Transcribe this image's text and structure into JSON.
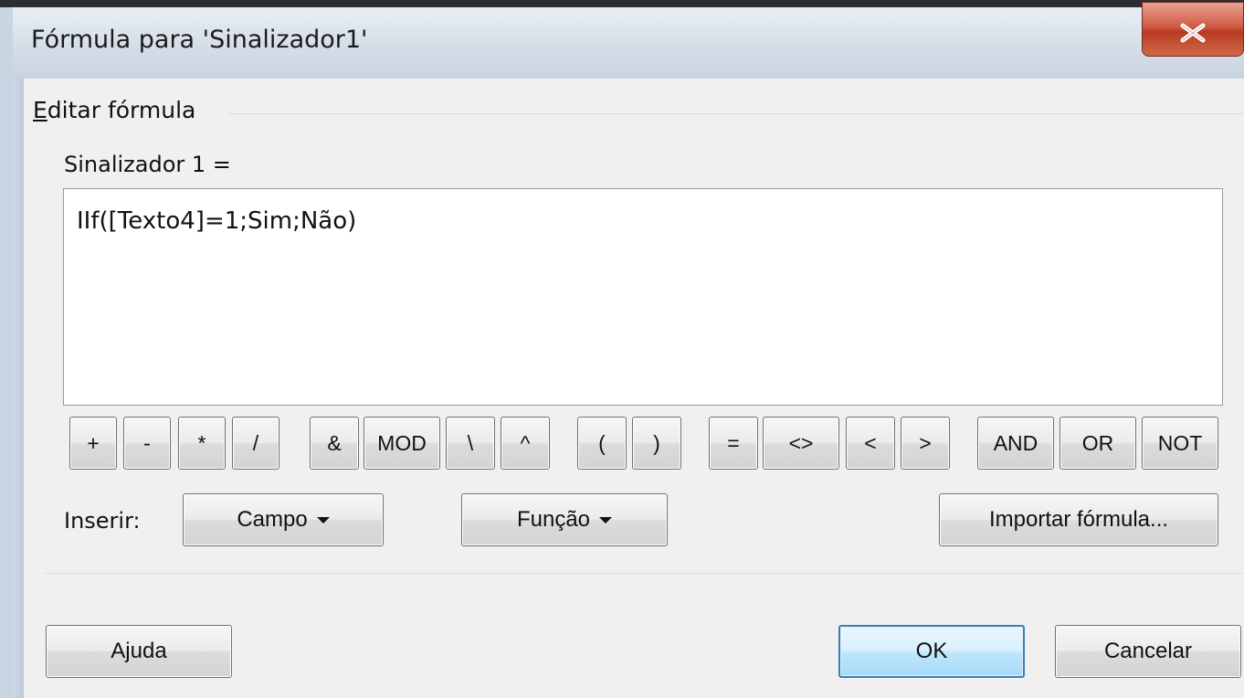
{
  "window": {
    "title": "Fórmula para 'Sinalizador1'"
  },
  "group": {
    "caption_underlined": "E",
    "caption_rest": "ditar fórmula"
  },
  "field": {
    "label": "Sinalizador 1 =",
    "formula": "IIf([Texto4]=1;Sim;Não)"
  },
  "operators": [
    "+",
    "-",
    "*",
    "/",
    "&",
    "MOD",
    "\\",
    "^",
    "(",
    ")",
    "=",
    "<>",
    "<",
    ">",
    "AND",
    "OR",
    "NOT"
  ],
  "insert": {
    "label": "Inserir:",
    "field_button": "Campo",
    "function_button": "Função",
    "import_button": "Importar fórmula..."
  },
  "footer": {
    "help_button": "Ajuda",
    "ok_button": "OK",
    "cancel_button": "Cancelar"
  },
  "colors": {
    "close_button": "#c7472f",
    "ok_border": "#3c7fb1",
    "frame": "#c9d5e2"
  },
  "icons": {
    "close": "close-icon",
    "dropdown": "chevron-down-icon"
  }
}
